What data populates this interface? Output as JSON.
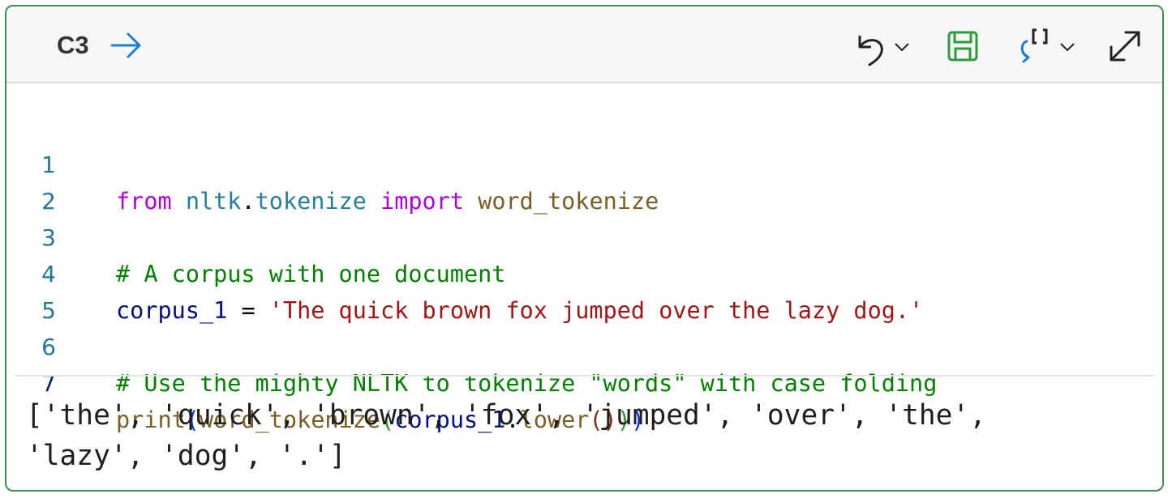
{
  "cell": {
    "ref": "C3",
    "icons": [
      "run-arrow-icon",
      "undo-icon",
      "chevron-down-icon",
      "save-icon",
      "transform-icon",
      "expand-icon"
    ],
    "accent_border": "#3f8f55"
  },
  "code": {
    "line_numbers": [
      "1",
      "2",
      "3",
      "4",
      "5",
      "6",
      "7"
    ],
    "line1": {
      "kw1": "from",
      "module": "nltk",
      "dot": ".",
      "submodule": "tokenize",
      "kw2": "import",
      "name": "word_tokenize"
    },
    "line3": {
      "comment": "# A corpus with one document"
    },
    "line4": {
      "var": "corpus_1",
      "eq": " = ",
      "string": "'The quick brown fox jumped over the lazy dog.'"
    },
    "line6": {
      "comment": "# Use the mighty NLTK to tokenize \"words\" with case folding"
    },
    "line7": {
      "print": "print",
      "paren_open1": "(",
      "fn": "word_tokenize",
      "paren_open2": "(",
      "var": "corpus_1",
      "dot": ".",
      "method": "lower",
      "parens3": "()",
      "paren_close2": ")",
      "paren_close1": ")"
    }
  },
  "output": {
    "text": "['the', 'quick', 'brown', 'fox', 'jumped', 'over', 'the', 'lazy', 'dog', '.']"
  }
}
